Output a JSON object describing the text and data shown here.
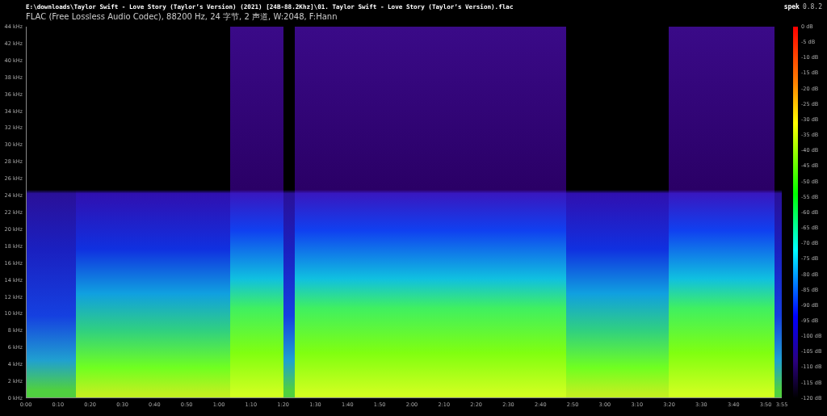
{
  "header": {
    "file_path": "E:\\downloads\\Taylor Swift - Love Story (Taylor’s Version) (2021) [24B-88.2Khz]\\01. Taylor Swift - Love Story (Taylor’s Version).flac",
    "stream_info": "FLAC (Free Lossless Audio Codec), 88200 Hz, 24 字节, 2 声道, W:2048, F:Hann",
    "app_name": "spek",
    "app_version": "0.8.2"
  },
  "frequency_axis": [
    "44 kHz",
    "42 kHz",
    "40 kHz",
    "38 kHz",
    "36 kHz",
    "34 kHz",
    "32 kHz",
    "30 kHz",
    "28 kHz",
    "26 kHz",
    "24 kHz",
    "22 kHz",
    "20 kHz",
    "18 kHz",
    "16 kHz",
    "14 kHz",
    "12 kHz",
    "10 kHz",
    "8 kHz",
    "6 kHz",
    "4 kHz",
    "2 kHz",
    "0 kHz"
  ],
  "time_axis": [
    "0:00",
    "0:10",
    "0:20",
    "0:30",
    "0:40",
    "0:50",
    "1:00",
    "1:10",
    "1:20",
    "1:30",
    "1:40",
    "1:50",
    "2:00",
    "2:10",
    "2:20",
    "2:30",
    "2:40",
    "2:50",
    "3:00",
    "3:10",
    "3:20",
    "3:30",
    "3:40",
    "3:50",
    "3:55"
  ],
  "level_scale": [
    "0 dB",
    "-5 dB",
    "-10 dB",
    "-15 dB",
    "-20 dB",
    "-25 dB",
    "-30 dB",
    "-35 dB",
    "-40 dB",
    "-45 dB",
    "-50 dB",
    "-55 dB",
    "-60 dB",
    "-65 dB",
    "-70 dB",
    "-75 dB",
    "-80 dB",
    "-85 dB",
    "-90 dB",
    "-95 dB",
    "-100 dB",
    "-105 dB",
    "-110 dB",
    "-115 dB",
    "-120 dB"
  ]
}
